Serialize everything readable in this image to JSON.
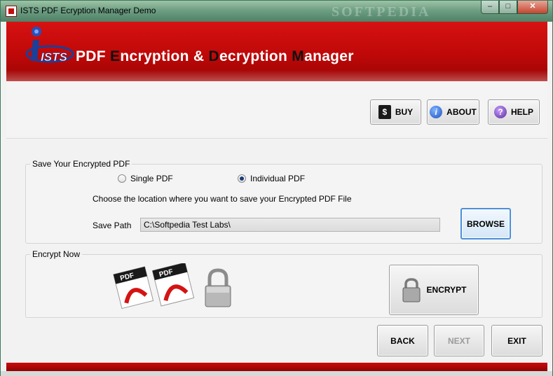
{
  "window": {
    "title": "ISTS PDF Ecryption Manager Demo",
    "watermark": "SOFTPEDIA",
    "minimize": "–",
    "maximize": "□",
    "close": "✕"
  },
  "banner": {
    "logo_text": "ISTS",
    "app_title_parts": [
      "PDF ",
      "E",
      "ncryption & ",
      "D",
      "ecryption ",
      "M",
      "anager"
    ]
  },
  "toolbar": {
    "buy_label": "BUY",
    "about_label": "ABOUT",
    "help_label": "HELP",
    "buy_icon_glyph": "$",
    "about_icon_glyph": "i",
    "help_icon_glyph": "?"
  },
  "save_group": {
    "label": "Save Your Encrypted PDF",
    "single_pdf_label": "Single PDF",
    "individual_pdf_label": "Individual PDF",
    "selected": "Individual PDF",
    "instruction": "Choose the location where you want to save your Encrypted PDF File",
    "save_path_label": "Save Path",
    "save_path_value": "C:\\Softpedia Test Labs\\",
    "browse_label": "BROWSE"
  },
  "encrypt_group": {
    "label": "Encrypt Now",
    "pdf_icon_text_1": "PDF",
    "pdf_icon_text_2": "PDF",
    "encrypt_label": "ENCRYPT"
  },
  "nav": {
    "back_label": "BACK",
    "next_label": "NEXT",
    "exit_label": "EXIT"
  },
  "colors": {
    "banner_red": "#c00808",
    "titlebar_green": "#6e9f83",
    "accent_blue": "#4a90d9"
  }
}
